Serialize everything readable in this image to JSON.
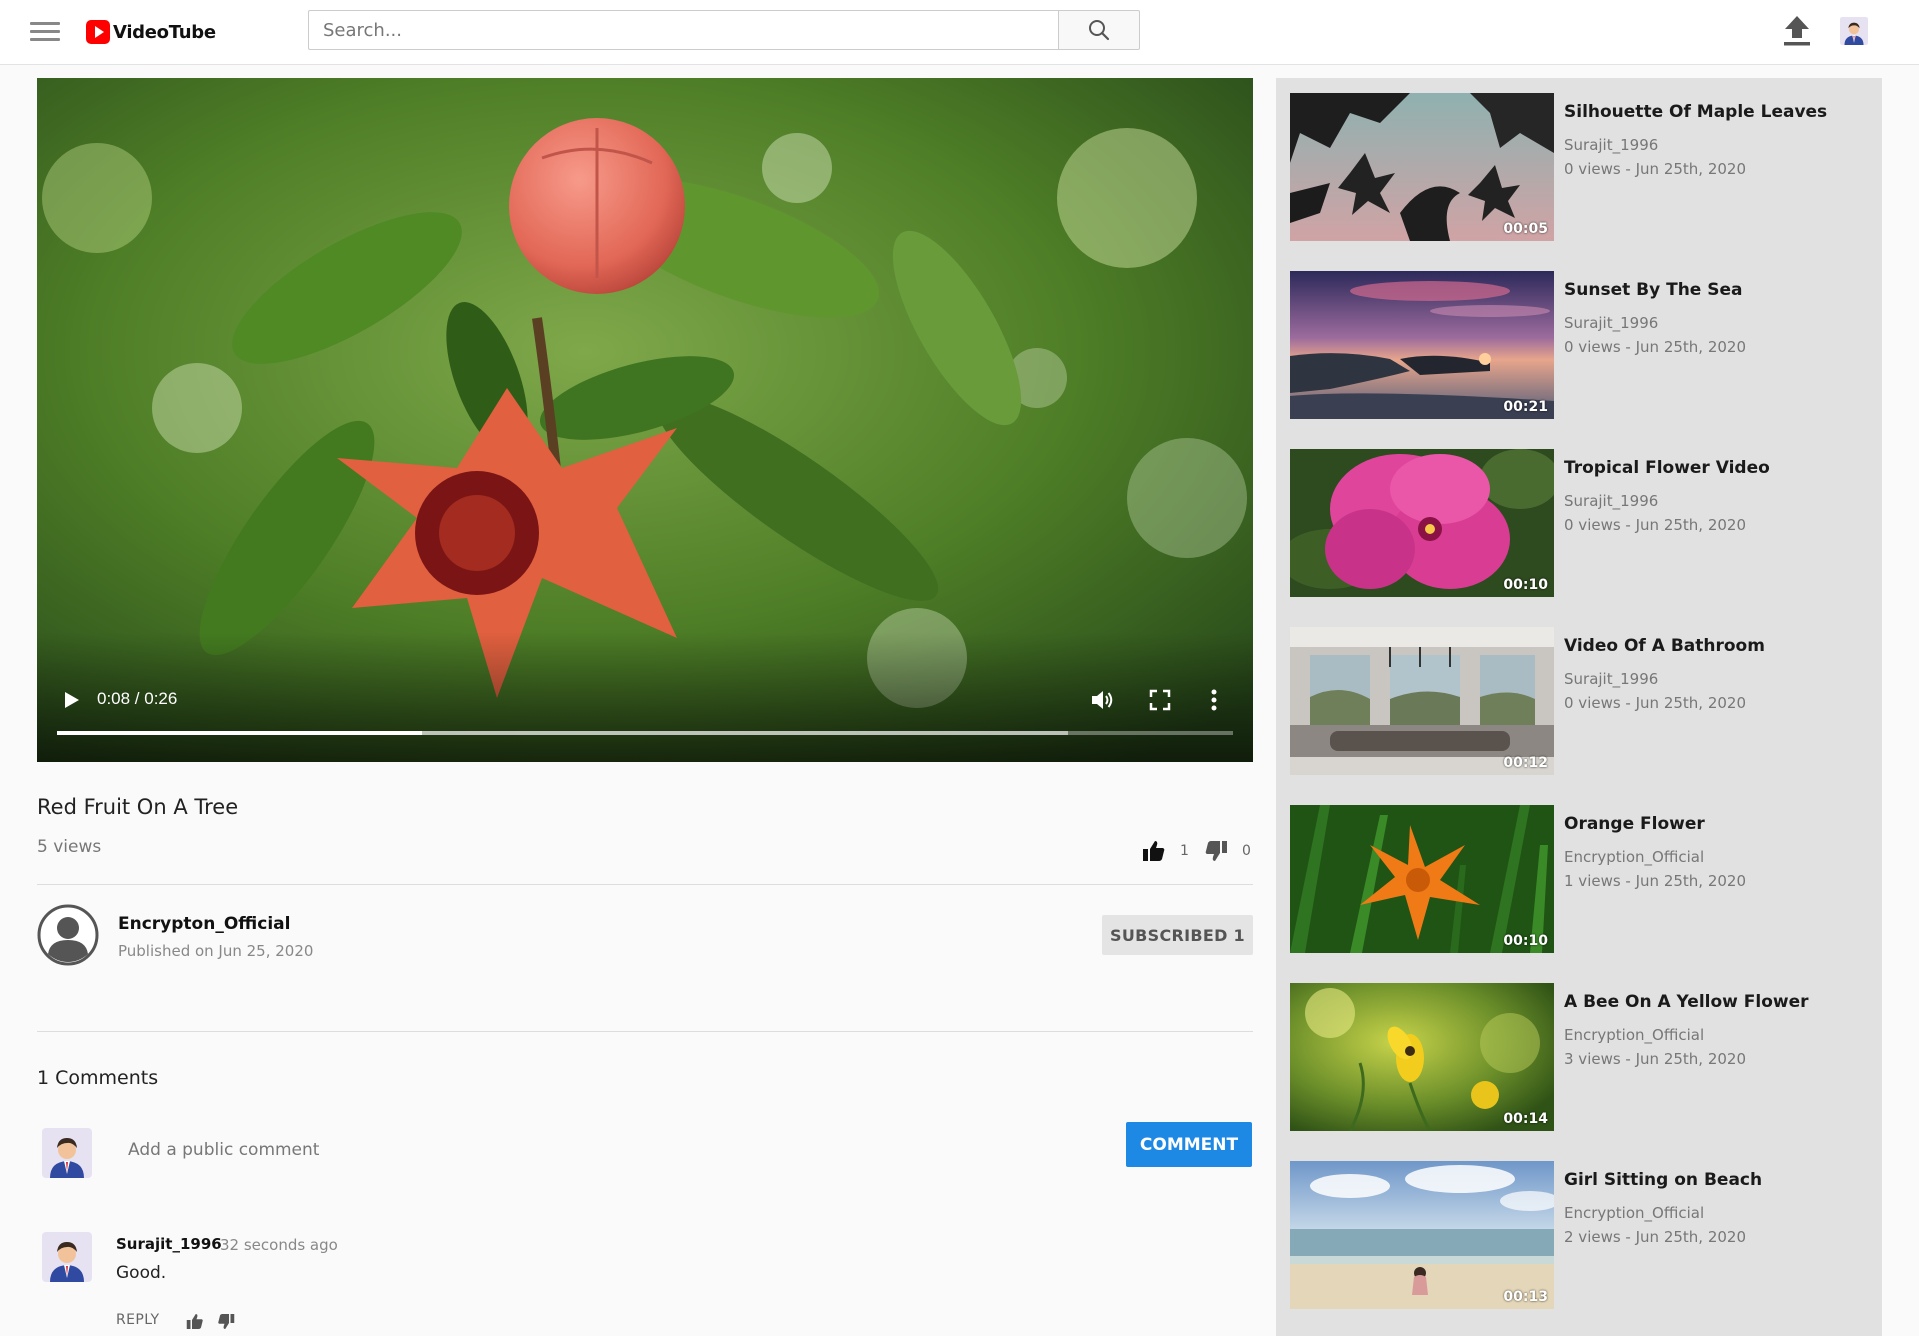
{
  "header": {
    "app_name": "VideoTube",
    "search_placeholder": "Search..."
  },
  "player": {
    "time": "0:08 / 0:26",
    "played_fraction": 0.31,
    "buffered_fraction": 0.86
  },
  "video": {
    "title": "Red Fruit On A Tree",
    "views": "5 views",
    "likes": "1",
    "dislikes": "0"
  },
  "channel": {
    "name": "Encrypton_Official",
    "published": "Published on Jun 25, 2020",
    "subscribe_label": "SUBSCRIBED 1"
  },
  "comments": {
    "count_label": "1 Comments",
    "input_placeholder": "Add a public comment",
    "submit_label": "COMMENT",
    "items": [
      {
        "author": "Surajit_1996",
        "time": "32 seconds ago",
        "text": "Good.",
        "reply_label": "REPLY"
      }
    ]
  },
  "recommendations": [
    {
      "title": "Silhouette Of Maple Leaves",
      "channel": "Surajit_1996",
      "meta": "0 views - Jun 25th, 2020",
      "duration": "00:05"
    },
    {
      "title": "Sunset By The Sea",
      "channel": "Surajit_1996",
      "meta": "0 views - Jun 25th, 2020",
      "duration": "00:21"
    },
    {
      "title": "Tropical Flower Video",
      "channel": "Surajit_1996",
      "meta": "0 views - Jun 25th, 2020",
      "duration": "00:10"
    },
    {
      "title": "Video Of A Bathroom",
      "channel": "Surajit_1996",
      "meta": "0 views - Jun 25th, 2020",
      "duration": "00:12"
    },
    {
      "title": "Orange Flower",
      "channel": "Encryption_Official",
      "meta": "1 views - Jun 25th, 2020",
      "duration": "00:10"
    },
    {
      "title": "A Bee On A Yellow Flower",
      "channel": "Encryption_Official",
      "meta": "3 views - Jun 25th, 2020",
      "duration": "00:14"
    },
    {
      "title": "Girl Sitting on Beach",
      "channel": "Encryption_Official",
      "meta": "2 views - Jun 25th, 2020",
      "duration": "00:13"
    }
  ],
  "colors": {
    "brand_red": "#ff0000",
    "accent_blue": "#1e88e5",
    "sidebar_bg": "#e1e1e1"
  }
}
